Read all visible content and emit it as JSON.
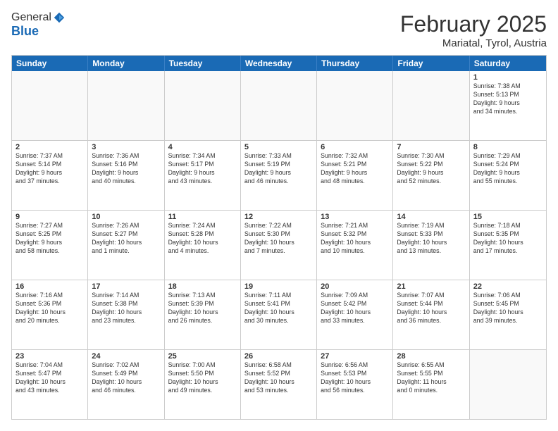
{
  "header": {
    "logo_general": "General",
    "logo_blue": "Blue",
    "month_year": "February 2025",
    "location": "Mariatal, Tyrol, Austria"
  },
  "weekdays": [
    "Sunday",
    "Monday",
    "Tuesday",
    "Wednesday",
    "Thursday",
    "Friday",
    "Saturday"
  ],
  "rows": [
    [
      {
        "day": "",
        "info": ""
      },
      {
        "day": "",
        "info": ""
      },
      {
        "day": "",
        "info": ""
      },
      {
        "day": "",
        "info": ""
      },
      {
        "day": "",
        "info": ""
      },
      {
        "day": "",
        "info": ""
      },
      {
        "day": "1",
        "info": "Sunrise: 7:38 AM\nSunset: 5:13 PM\nDaylight: 9 hours\nand 34 minutes."
      }
    ],
    [
      {
        "day": "2",
        "info": "Sunrise: 7:37 AM\nSunset: 5:14 PM\nDaylight: 9 hours\nand 37 minutes."
      },
      {
        "day": "3",
        "info": "Sunrise: 7:36 AM\nSunset: 5:16 PM\nDaylight: 9 hours\nand 40 minutes."
      },
      {
        "day": "4",
        "info": "Sunrise: 7:34 AM\nSunset: 5:17 PM\nDaylight: 9 hours\nand 43 minutes."
      },
      {
        "day": "5",
        "info": "Sunrise: 7:33 AM\nSunset: 5:19 PM\nDaylight: 9 hours\nand 46 minutes."
      },
      {
        "day": "6",
        "info": "Sunrise: 7:32 AM\nSunset: 5:21 PM\nDaylight: 9 hours\nand 48 minutes."
      },
      {
        "day": "7",
        "info": "Sunrise: 7:30 AM\nSunset: 5:22 PM\nDaylight: 9 hours\nand 52 minutes."
      },
      {
        "day": "8",
        "info": "Sunrise: 7:29 AM\nSunset: 5:24 PM\nDaylight: 9 hours\nand 55 minutes."
      }
    ],
    [
      {
        "day": "9",
        "info": "Sunrise: 7:27 AM\nSunset: 5:25 PM\nDaylight: 9 hours\nand 58 minutes."
      },
      {
        "day": "10",
        "info": "Sunrise: 7:26 AM\nSunset: 5:27 PM\nDaylight: 10 hours\nand 1 minute."
      },
      {
        "day": "11",
        "info": "Sunrise: 7:24 AM\nSunset: 5:28 PM\nDaylight: 10 hours\nand 4 minutes."
      },
      {
        "day": "12",
        "info": "Sunrise: 7:22 AM\nSunset: 5:30 PM\nDaylight: 10 hours\nand 7 minutes."
      },
      {
        "day": "13",
        "info": "Sunrise: 7:21 AM\nSunset: 5:32 PM\nDaylight: 10 hours\nand 10 minutes."
      },
      {
        "day": "14",
        "info": "Sunrise: 7:19 AM\nSunset: 5:33 PM\nDaylight: 10 hours\nand 13 minutes."
      },
      {
        "day": "15",
        "info": "Sunrise: 7:18 AM\nSunset: 5:35 PM\nDaylight: 10 hours\nand 17 minutes."
      }
    ],
    [
      {
        "day": "16",
        "info": "Sunrise: 7:16 AM\nSunset: 5:36 PM\nDaylight: 10 hours\nand 20 minutes."
      },
      {
        "day": "17",
        "info": "Sunrise: 7:14 AM\nSunset: 5:38 PM\nDaylight: 10 hours\nand 23 minutes."
      },
      {
        "day": "18",
        "info": "Sunrise: 7:13 AM\nSunset: 5:39 PM\nDaylight: 10 hours\nand 26 minutes."
      },
      {
        "day": "19",
        "info": "Sunrise: 7:11 AM\nSunset: 5:41 PM\nDaylight: 10 hours\nand 30 minutes."
      },
      {
        "day": "20",
        "info": "Sunrise: 7:09 AM\nSunset: 5:42 PM\nDaylight: 10 hours\nand 33 minutes."
      },
      {
        "day": "21",
        "info": "Sunrise: 7:07 AM\nSunset: 5:44 PM\nDaylight: 10 hours\nand 36 minutes."
      },
      {
        "day": "22",
        "info": "Sunrise: 7:06 AM\nSunset: 5:45 PM\nDaylight: 10 hours\nand 39 minutes."
      }
    ],
    [
      {
        "day": "23",
        "info": "Sunrise: 7:04 AM\nSunset: 5:47 PM\nDaylight: 10 hours\nand 43 minutes."
      },
      {
        "day": "24",
        "info": "Sunrise: 7:02 AM\nSunset: 5:49 PM\nDaylight: 10 hours\nand 46 minutes."
      },
      {
        "day": "25",
        "info": "Sunrise: 7:00 AM\nSunset: 5:50 PM\nDaylight: 10 hours\nand 49 minutes."
      },
      {
        "day": "26",
        "info": "Sunrise: 6:58 AM\nSunset: 5:52 PM\nDaylight: 10 hours\nand 53 minutes."
      },
      {
        "day": "27",
        "info": "Sunrise: 6:56 AM\nSunset: 5:53 PM\nDaylight: 10 hours\nand 56 minutes."
      },
      {
        "day": "28",
        "info": "Sunrise: 6:55 AM\nSunset: 5:55 PM\nDaylight: 11 hours\nand 0 minutes."
      },
      {
        "day": "",
        "info": ""
      }
    ]
  ]
}
